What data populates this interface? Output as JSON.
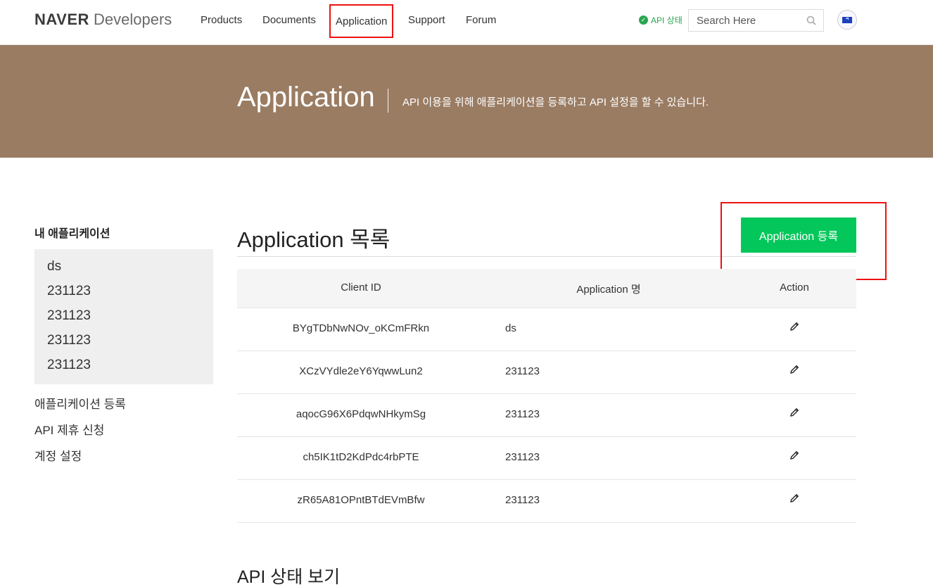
{
  "header": {
    "logo_brand": "NAVER",
    "logo_dev": "Developers",
    "nav": [
      "Products",
      "Documents",
      "Application",
      "Support",
      "Forum"
    ],
    "api_status": "API 상태",
    "search_placeholder": "Search Here"
  },
  "hero": {
    "title": "Application",
    "subtitle": "API 이용을 위해 애플리케이션을 등록하고 API 설정을 할 수 있습니다."
  },
  "sidebar": {
    "title": "내 애플리케이션",
    "apps": [
      "ds",
      "231123",
      "231123",
      "231123",
      "231123"
    ],
    "links": [
      "애플리케이션 등록",
      "API 제휴 신청",
      "계정 설정"
    ]
  },
  "main": {
    "title": "Application 목록",
    "register_button": "Application 등록",
    "columns": [
      "Client ID",
      "Application 명",
      "Action"
    ],
    "rows": [
      {
        "client_id": "BYgTDbNwNOv_oKCmFRkn",
        "name": "ds"
      },
      {
        "client_id": "XCzVYdle2eY6YqwwLun2",
        "name": "231123"
      },
      {
        "client_id": "aqocG96X6PdqwNHkymSg",
        "name": "231123"
      },
      {
        "client_id": "ch5IK1tD2KdPdc4rbPTE",
        "name": "231123"
      },
      {
        "client_id": "zR65A81OPntBTdEVmBfw",
        "name": "231123"
      }
    ],
    "section2_title": "API 상태 보기"
  },
  "colors": {
    "hero_bg": "#9a7c63",
    "primary_green": "#03c75a",
    "highlight_red": "#ee1111"
  }
}
